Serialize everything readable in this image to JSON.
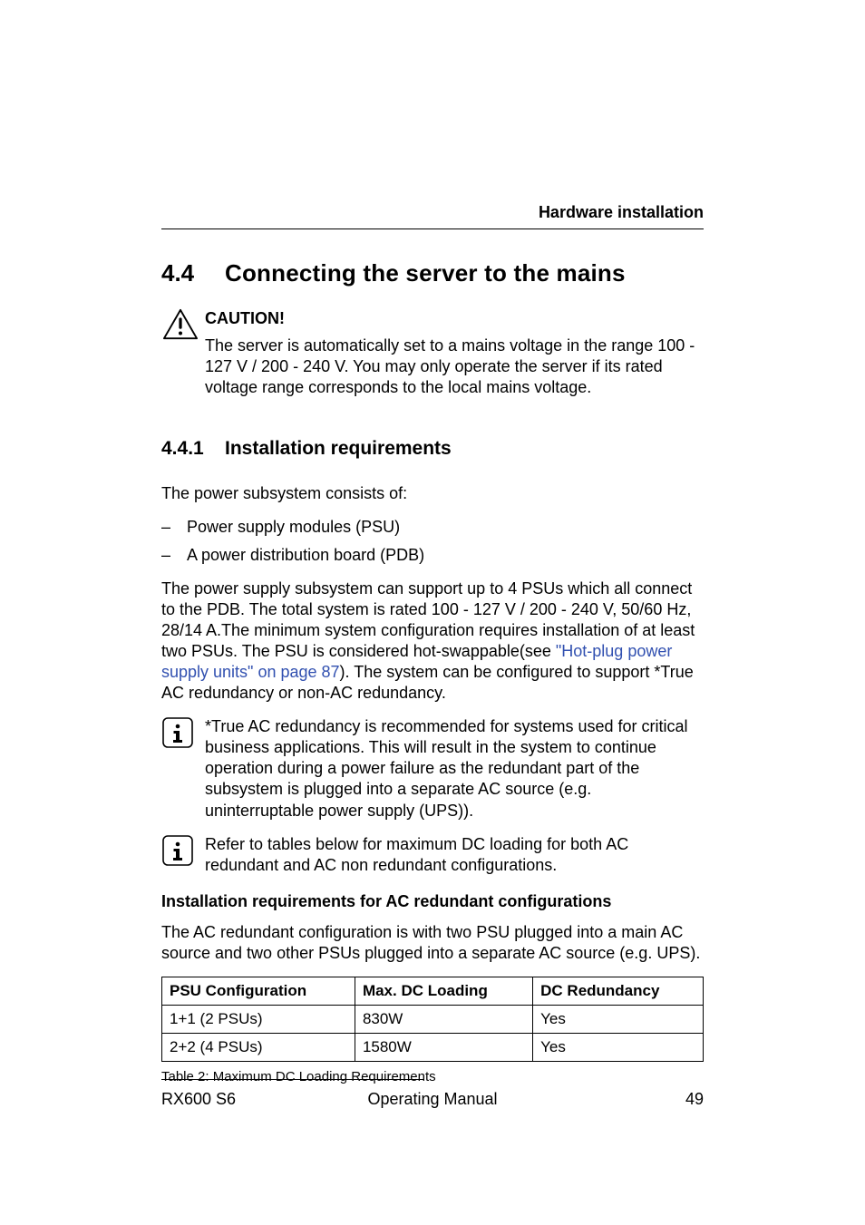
{
  "running_head": "Hardware installation",
  "h1": {
    "num": "4.4",
    "title": "Connecting the server to the mains"
  },
  "caution": {
    "title": "CAUTION!",
    "body": "The server is automatically set to a mains voltage in the range 100 - 127 V / 200 - 240 V. You may only operate the server if its rated voltage range corresponds to the local mains voltage."
  },
  "h2": {
    "num": "4.4.1",
    "title": "Installation requirements"
  },
  "intro": "The power subsystem consists of:",
  "bullets": [
    "Power supply modules (PSU)",
    "A power distribution board (PDB)"
  ],
  "para1_a": "The power supply subsystem can support up to 4 PSUs which all connect to the PDB. The total system is rated 100 - 127 V / 200 - 240 V, 50/60 Hz, 28/14 A.The minimum system configuration requires installation of at least two PSUs. The PSU is considered hot-swappable(see ",
  "para1_link": "\"Hot-plug power supply units\" on page 87",
  "para1_b": "). The system can be configured to support *True AC redundancy or non-AC redundancy.",
  "info1": "*True AC redundancy is recommended for systems used for critical business applications. This will result in the system to continue operation during a power failure as the redundant part of the subsystem is plugged into a separate AC source (e.g. uninterruptable power supply (UPS)).",
  "info2": "Refer to tables below for maximum DC loading for both AC redundant and AC non redundant configurations.",
  "sub_head": "Installation requirements for AC redundant configurations",
  "para2": "The AC redundant configuration is with two PSU plugged into a main AC source and two other PSUs plugged into a separate AC source (e.g. UPS).",
  "table": {
    "headers": [
      "PSU Configuration",
      "Max. DC Loading",
      "DC Redundancy"
    ],
    "rows": [
      [
        "1+1 (2 PSUs)",
        "830W",
        "Yes"
      ],
      [
        "2+2 (4 PSUs)",
        "1580W",
        "Yes"
      ]
    ],
    "caption": "Table 2: Maximum DC Loading Requirements"
  },
  "footer": {
    "left": "RX600 S6",
    "center": "Operating Manual",
    "right": "49"
  }
}
